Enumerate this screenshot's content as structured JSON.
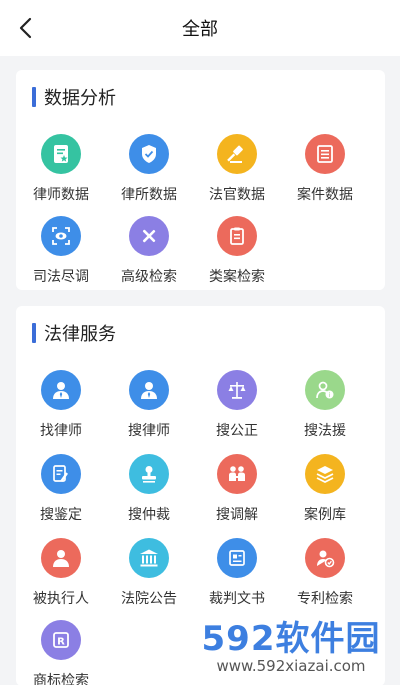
{
  "header": {
    "title": "全部"
  },
  "sections": [
    {
      "title": "数据分析",
      "items": [
        {
          "label": "律师数据",
          "icon": "lawyer-data-icon",
          "color": "#35c3a1"
        },
        {
          "label": "律所数据",
          "icon": "law-firm-shield-icon",
          "color": "#3e8ee8"
        },
        {
          "label": "法官数据",
          "icon": "gavel-icon",
          "color": "#f4b41f"
        },
        {
          "label": "案件数据",
          "icon": "case-list-icon",
          "color": "#ec6a5c"
        },
        {
          "label": "司法尽调",
          "icon": "eye-scan-icon",
          "color": "#3e8ee8"
        },
        {
          "label": "高级检索",
          "icon": "tools-icon",
          "color": "#8b7fe4"
        },
        {
          "label": "类案检索",
          "icon": "clipboard-icon",
          "color": "#ec6a5c"
        }
      ]
    },
    {
      "title": "法律服务",
      "items": [
        {
          "label": "找律师",
          "icon": "lawyer-avatar-icon",
          "color": "#3e8ee8"
        },
        {
          "label": "搜律师",
          "icon": "lawyer-avatar-icon",
          "color": "#3e8ee8"
        },
        {
          "label": "搜公正",
          "icon": "scales-icon",
          "color": "#8b7fe4"
        },
        {
          "label": "搜法援",
          "icon": "user-help-icon",
          "color": "#9ad88b"
        },
        {
          "label": "搜鉴定",
          "icon": "document-edit-icon",
          "color": "#3e8ee8"
        },
        {
          "label": "搜仲裁",
          "icon": "stamp-icon",
          "color": "#3ebde0"
        },
        {
          "label": "搜调解",
          "icon": "mediation-icon",
          "color": "#ec6a5c"
        },
        {
          "label": "案例库",
          "icon": "layers-icon",
          "color": "#f4b41f"
        },
        {
          "label": "被执行人",
          "icon": "person-icon",
          "color": "#ec6a5c"
        },
        {
          "label": "法院公告",
          "icon": "court-icon",
          "color": "#3ebde0"
        },
        {
          "label": "裁判文书",
          "icon": "document-icon",
          "color": "#3e8ee8"
        },
        {
          "label": "专利检索",
          "icon": "patent-user-icon",
          "color": "#ec6a5c"
        },
        {
          "label": "商标检索",
          "icon": "trademark-icon",
          "color": "#8b7fe4"
        }
      ]
    }
  ],
  "watermark": {
    "brand": "592软件园",
    "url": "www.592xiazai.com"
  }
}
